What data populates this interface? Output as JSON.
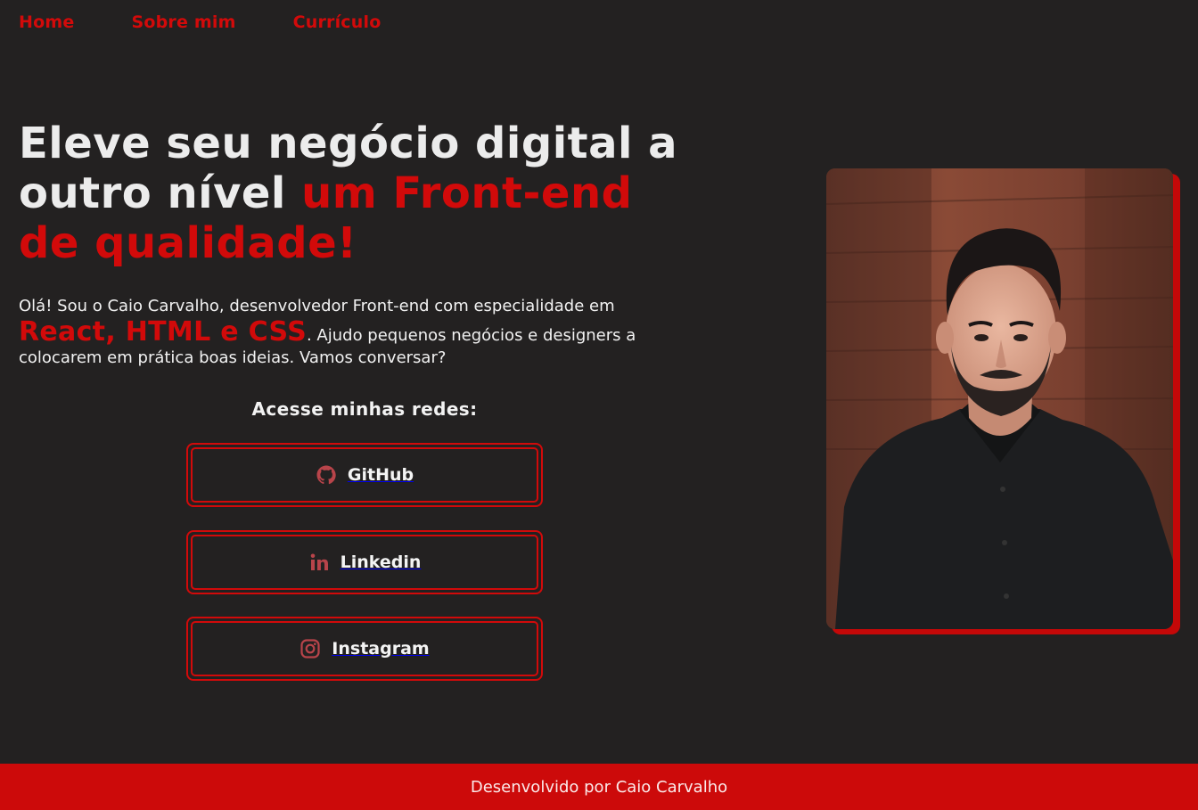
{
  "nav": {
    "items": [
      {
        "label": "Home"
      },
      {
        "label": "Sobre mim"
      },
      {
        "label": "Currículo"
      }
    ]
  },
  "hero": {
    "headline_white": "Eleve seu negócio digital a outro nível ",
    "headline_red": "um Front-end de qualidade!",
    "intro_before": "Olá! Sou o Caio Carvalho, desenvolvedor Front-end com especialidade em ",
    "intro_tech": "React, HTML e CSS",
    "intro_after": ". Ajudo pequenos negócios e designers a colocarem em prática boas ideias. Vamos conversar?"
  },
  "social": {
    "title": "Acesse minhas redes:",
    "buttons": [
      {
        "label": "GitHub",
        "icon": "github-icon"
      },
      {
        "label": "Linkedin",
        "icon": "linkedin-icon"
      },
      {
        "label": "Instagram",
        "icon": "instagram-icon"
      }
    ]
  },
  "profile_photo": {
    "icon": "profile-photo"
  },
  "footer": {
    "text": "Desenvolvido por Caio Carvalho"
  },
  "colors": {
    "background": "#232121",
    "accent": "#d20a0a",
    "footer": "#cc0a0a"
  }
}
